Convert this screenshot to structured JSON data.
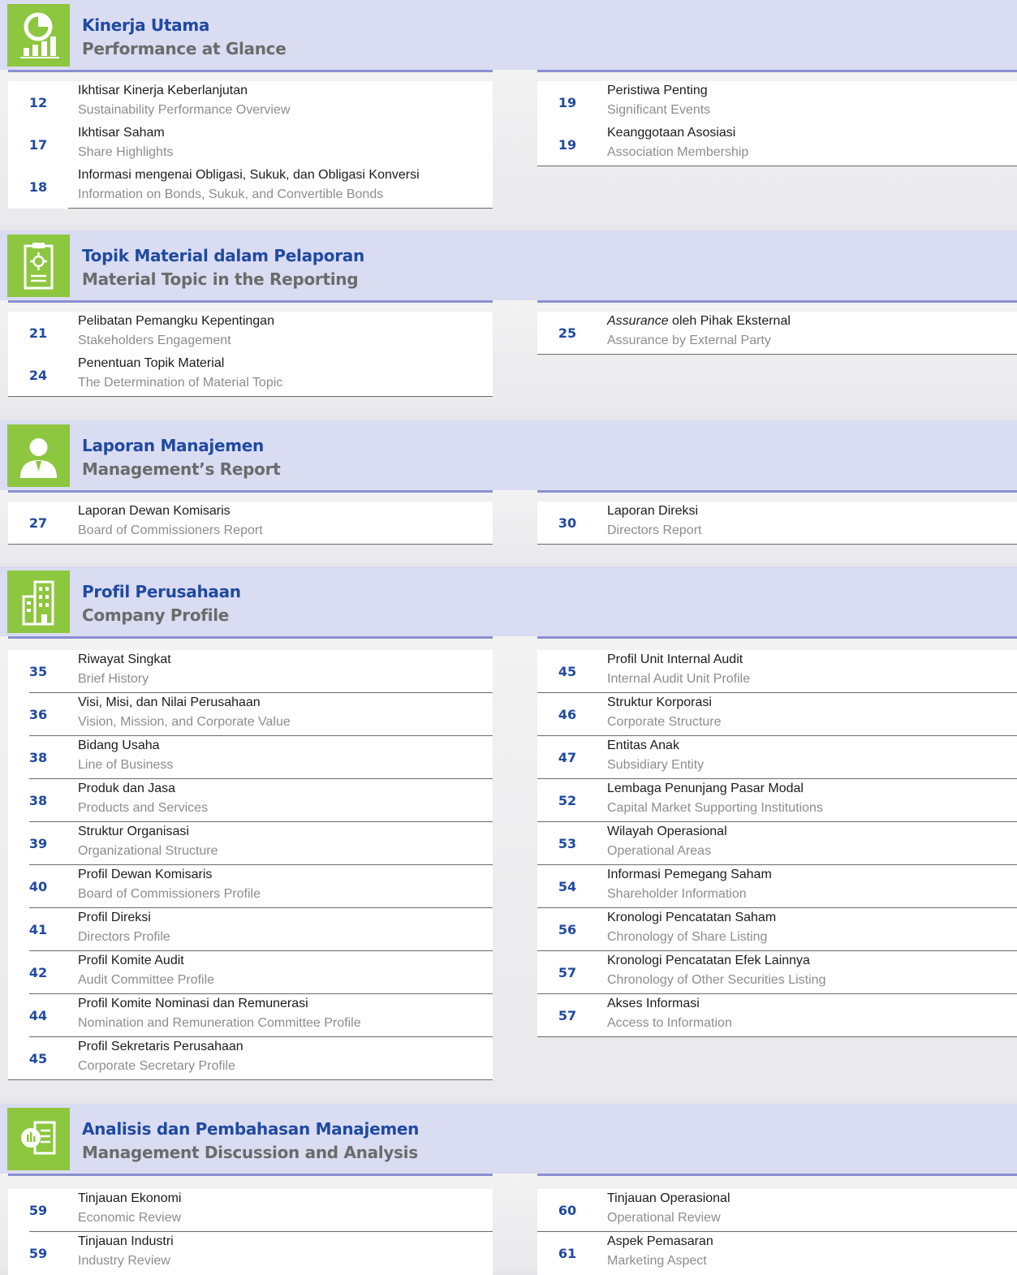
{
  "sections": [
    {
      "title": "Kinerja Utama",
      "subtitle": "Performance at Glance",
      "icon": "performance-chart-icon",
      "left": [
        {
          "page": "12",
          "id": "Ikhtisar Kinerja Keberlanjutan",
          "en": "Sustainability Performance Overview"
        },
        {
          "page": "17",
          "id": "Ikhtisar Saham",
          "en": "Share Highlights"
        },
        {
          "page": "18",
          "id": "Informasi mengenai Obligasi, Sukuk, dan Obligasi Konversi",
          "en": "Information on Bonds, Sukuk, and Convertible Bonds"
        }
      ],
      "right": [
        {
          "page": "19",
          "id": "Peristiwa Penting",
          "en": "Significant Events"
        },
        {
          "page": "19",
          "id": "Keanggotaan Asosiasi",
          "en": "Association Membership"
        }
      ]
    },
    {
      "title": "Topik Material dalam Pelaporan",
      "subtitle": "Material Topic in the Reporting",
      "icon": "clipboard-gear-icon",
      "left": [
        {
          "page": "21",
          "id": "Pelibatan Pemangku Kepentingan",
          "en": "Stakeholders Engagement"
        },
        {
          "page": "24",
          "id": "Penentuan Topik Material",
          "en": "The Determination of Material Topic"
        }
      ],
      "right": [
        {
          "page": "25",
          "id_italic": "Assurance",
          "id": " oleh Pihak Eksternal",
          "en": "Assurance by External Party"
        }
      ]
    },
    {
      "title": "Laporan Manajemen",
      "subtitle": "Management’s Report",
      "icon": "manager-person-icon",
      "left": [
        {
          "page": "27",
          "id": "Laporan Dewan Komisaris",
          "en": "Board of Commissioners Report"
        }
      ],
      "right": [
        {
          "page": "30",
          "id": "Laporan Direksi",
          "en": "Directors Report"
        }
      ]
    },
    {
      "title": "Profil Perusahaan",
      "subtitle": "Company Profile",
      "icon": "building-icon",
      "left": [
        {
          "page": "35",
          "id": "Riwayat Singkat",
          "en": "Brief History"
        },
        {
          "page": "36",
          "id": "Visi, Misi, dan Nilai Perusahaan",
          "en": "Vision, Mission, and Corporate Value"
        },
        {
          "page": "38",
          "id": "Bidang Usaha",
          "en": "Line of Business"
        },
        {
          "page": "38",
          "id": "Produk dan Jasa",
          "en": "Products and Services"
        },
        {
          "page": "39",
          "id": "Struktur Organisasi",
          "en": "Organizational Structure"
        },
        {
          "page": "40",
          "id": "Profil Dewan Komisaris",
          "en": "Board of Commissioners Profile"
        },
        {
          "page": "41",
          "id": "Profil Direksi",
          "en": "Directors Profile"
        },
        {
          "page": "42",
          "id": "Profil Komite Audit",
          "en": "Audit Committee Profile"
        },
        {
          "page": "44",
          "id": "Profil Komite Nominasi dan Remunerasi",
          "en": "Nomination and Remuneration Committee Profile"
        },
        {
          "page": "45",
          "id": "Profil Sekretaris Perusahaan",
          "en": "Corporate Secretary Profile"
        }
      ],
      "right": [
        {
          "page": "45",
          "id": "Profil Unit Internal Audit",
          "en": "Internal Audit Unit Profile"
        },
        {
          "page": "46",
          "id": "Struktur Korporasi",
          "en": "Corporate Structure"
        },
        {
          "page": "47",
          "id": "Entitas Anak",
          "en": "Subsidiary Entity"
        },
        {
          "page": "52",
          "id": "Lembaga Penunjang Pasar Modal",
          "en": "Capital Market Supporting Institutions"
        },
        {
          "page": "53",
          "id": "Wilayah Operasional",
          "en": "Operational Areas"
        },
        {
          "page": "54",
          "id": "Informasi Pemegang Saham",
          "en": "Shareholder Information"
        },
        {
          "page": "56",
          "id": "Kronologi Pencatatan Saham",
          "en": "Chronology of Share Listing"
        },
        {
          "page": "57",
          "id": "Kronologi Pencatatan Efek Lainnya",
          "en": "Chronology of Other Securities Listing"
        },
        {
          "page": "57",
          "id": "Akses Informasi",
          "en": "Access to Information"
        }
      ]
    },
    {
      "title": "Analisis dan Pembahasan Manajemen",
      "subtitle": "Management Discussion and Analysis",
      "icon": "analysis-document-icon",
      "left": [
        {
          "page": "59",
          "id": "Tinjauan Ekonomi",
          "en": "Economic Review"
        },
        {
          "page": "59",
          "id": "Tinjauan Industri",
          "en": "Industry Review"
        }
      ],
      "right": [
        {
          "page": "60",
          "id": "Tinjauan Operasional",
          "en": "Operational Review"
        },
        {
          "page": "61",
          "id": "Aspek Pemasaran",
          "en": "Marketing Aspect"
        }
      ]
    }
  ]
}
